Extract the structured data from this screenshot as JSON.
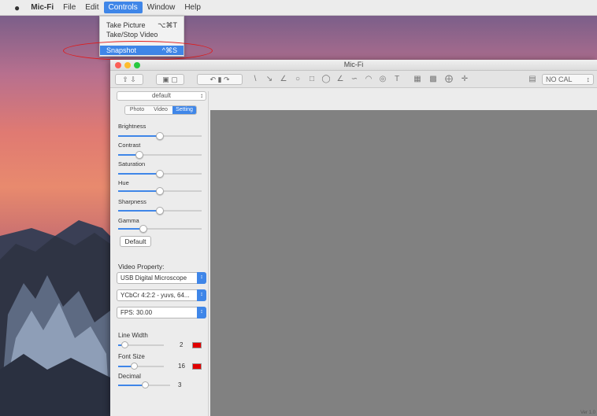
{
  "menubar": {
    "apple": "",
    "app": "Mic-Fi",
    "items": [
      "File",
      "Edit",
      "Controls",
      "Window",
      "Help"
    ],
    "active": "Controls"
  },
  "dropdown": {
    "items": [
      {
        "label": "Take Picture",
        "shortcut": "⌥⌘T"
      },
      {
        "label": "Take/Stop Video",
        "shortcut": ""
      },
      {
        "label": "Snapshot",
        "shortcut": "^⌘S"
      }
    ],
    "selected": "Snapshot"
  },
  "window": {
    "title": "Mic-Fi",
    "toolbar": {
      "calibration": "NO CAL"
    },
    "profile": "default",
    "tabs": [
      "Photo",
      "Video",
      "Setting"
    ],
    "active_tab": "Setting",
    "sliders": [
      {
        "label": "Brightness",
        "value": 0.5
      },
      {
        "label": "Contrast",
        "value": 0.25
      },
      {
        "label": "Saturation",
        "value": 0.5
      },
      {
        "label": "Hue",
        "value": 0.5
      },
      {
        "label": "Sharpness",
        "value": 0.5
      },
      {
        "label": "Gamma",
        "value": 0.3
      }
    ],
    "default_button": "Default",
    "video_property": {
      "label": "Video Property:",
      "device": "USB Digital Microscope",
      "format": "YCbCr 4:2:2 - yuvs, 64...",
      "fps": "FPS: 30.00"
    },
    "line_width": {
      "label": "Line Width",
      "value": "2",
      "color": "#e00000"
    },
    "font_size": {
      "label": "Font Size",
      "value": "16",
      "color": "#e00000"
    },
    "decimal": {
      "label": "Decimal",
      "value": "3"
    },
    "status": "Ver 1.0"
  }
}
